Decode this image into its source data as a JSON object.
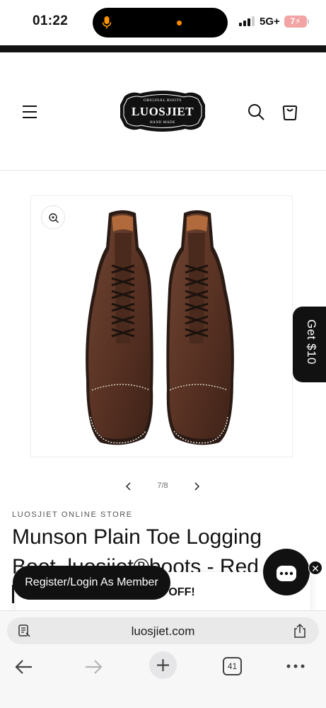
{
  "status_bar": {
    "time": "01:22",
    "network": "5G+",
    "battery": "7"
  },
  "header": {
    "logo_text": "LUOSJIET",
    "logo_top_text": "ORIGINAL BOOTS",
    "logo_bottom_text": "HAND MADE"
  },
  "product": {
    "vendor": "LUOSJIET ONLINE STORE",
    "title_line1": "Munson Plain Toe Logging",
    "title_line2": "Boot, luosjiet®boots - Red",
    "image_counter": "7/8"
  },
  "promo": {
    "tab_label": "Get $10",
    "banner_text": "0 OFF!",
    "register_label": "Register/Login As Member"
  },
  "browser": {
    "url": "luosjiet.com",
    "tab_count": "41"
  },
  "colors": {
    "accent_black": "#111111",
    "island_dot": "#ff8a00",
    "battery_bg": "#f2a4a4",
    "mic_color": "#ff9500"
  }
}
